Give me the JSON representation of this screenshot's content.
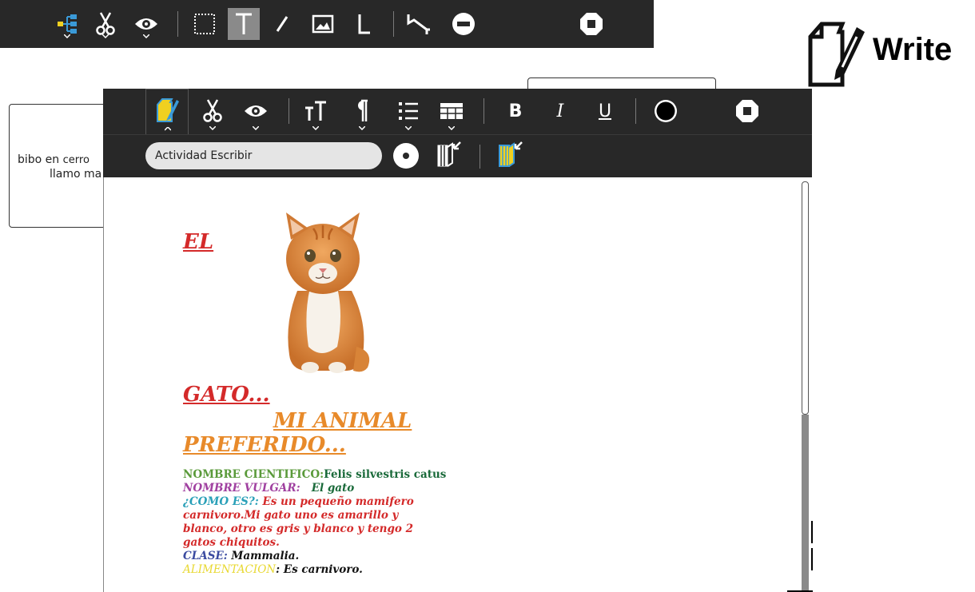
{
  "brand": {
    "name": "Write"
  },
  "background": {
    "text_line1_a": "bibo en",
    "text_line1_b": "cerro",
    "text_line2": "llamo ma"
  },
  "toolbar": {
    "title_value": "Actividad Escribir",
    "bold_label": "B",
    "italic_label": "I",
    "underline_label": "U",
    "text_size_label": "TT",
    "paragraph_label": "¶"
  },
  "document": {
    "heading_el": "EL ",
    "heading_gato": "GATO...",
    "heading_mi_animal": "MI ANIMAL ",
    "heading_preferido": "PREFERIDO...",
    "nombre_cientifico_label": "NOMBRE CIENTIFICO:",
    "nombre_cientifico_value": "Felis silvestris catus",
    "nombre_vulgar_label": "NOMBRE VULGAR:",
    "nombre_vulgar_value": "El gato",
    "como_es_label": "¿COMO ES?:",
    "como_es_value_1": " Es un pequeño mamifero",
    "como_es_value_2": "carnivoro.Mi gato uno es amarillo y",
    "como_es_value_3": "blanco, otro es gris y blanco y tengo 2",
    "como_es_value_4": "gatos chiquitos.",
    "clase_label": "CLASE:",
    "clase_value": " Mammalia.",
    "alimentacion_label": "ALIMENTACION",
    "alimentacion_value": ": Es carnivoro."
  },
  "colors": {
    "toolbar_bg": "#282828",
    "red": "#d42a2a",
    "orange": "#e88a2a",
    "green": "#5a9a3a",
    "purple": "#a040a0",
    "teal": "#2aa0b8",
    "navy": "#3a4aa0",
    "yellow": "#e8d830",
    "dark_green": "#1a6a3a",
    "icon_yellow": "#f0d020",
    "icon_blue": "#3a9ad8"
  }
}
